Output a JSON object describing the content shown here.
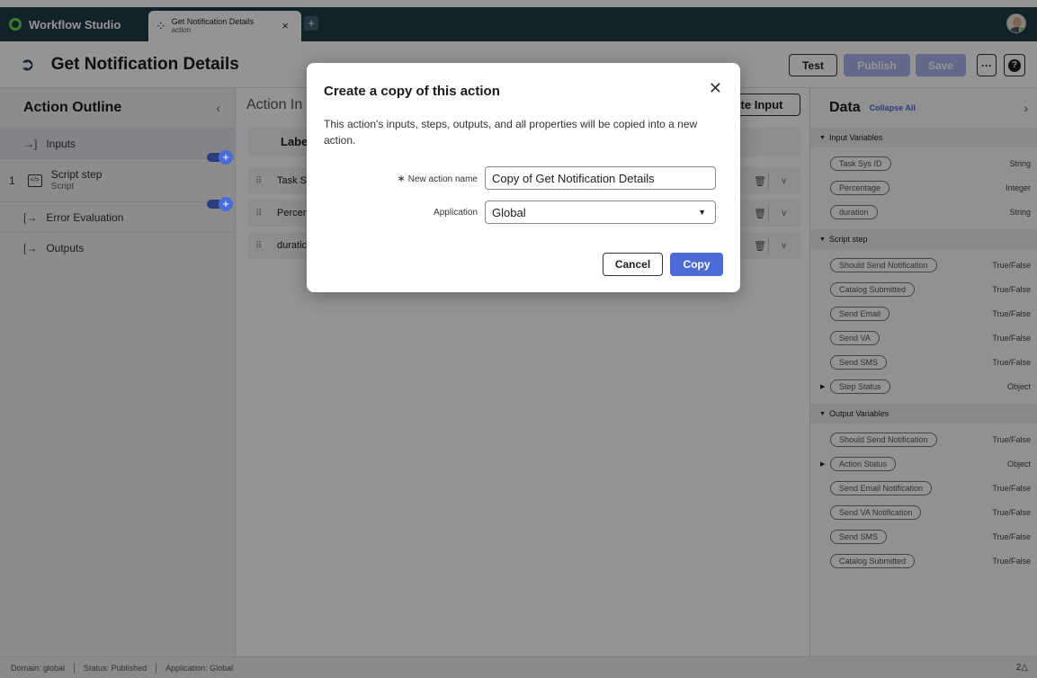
{
  "app": {
    "name": "Workflow Studio"
  },
  "tab": {
    "title": "Get Notification Details",
    "subtitle": "action",
    "close": "×",
    "add": "+"
  },
  "header": {
    "title": "Get Notification Details",
    "buttons": {
      "test": "Test",
      "publish": "Publish",
      "save": "Save",
      "more": "···",
      "help": "?"
    }
  },
  "outline": {
    "title": "Action Outline",
    "collapse": "‹",
    "inputs": "Inputs",
    "step": {
      "number": "1",
      "label": "Script step",
      "sublabel": "Script",
      "icon_text": "</>"
    },
    "error": "Error Evaluation",
    "outputs": "Outputs",
    "plus": "+"
  },
  "middle": {
    "heading": "Action In",
    "create_button": "te Input",
    "table_header": "Labe",
    "rows": [
      {
        "name": "Task Sy"
      },
      {
        "name": "Percen"
      },
      {
        "name": "duratic"
      }
    ]
  },
  "data_panel": {
    "title": "Data",
    "collapse_all": "Collapse All",
    "chevron": "›",
    "sections": [
      {
        "title": "Input Variables",
        "items": [
          {
            "name": "Task Sys ID",
            "type": "String",
            "expandable": false
          },
          {
            "name": "Percentage",
            "type": "Integer",
            "expandable": false
          },
          {
            "name": "duration",
            "type": "String",
            "expandable": false
          }
        ]
      },
      {
        "title": "Script step",
        "items": [
          {
            "name": "Should Send Notification",
            "type": "True/False",
            "expandable": false
          },
          {
            "name": "Catalog Submitted",
            "type": "True/False",
            "expandable": false
          },
          {
            "name": "Send Email",
            "type": "True/False",
            "expandable": false
          },
          {
            "name": "Send VA",
            "type": "True/False",
            "expandable": false
          },
          {
            "name": "Send SMS",
            "type": "True/False",
            "expandable": false
          },
          {
            "name": "Step Status",
            "type": "Object",
            "expandable": true
          }
        ]
      },
      {
        "title": "Output Variables",
        "items": [
          {
            "name": "Should Send Notification",
            "type": "True/False",
            "expandable": false
          },
          {
            "name": "Action Status",
            "type": "Object",
            "expandable": true
          },
          {
            "name": "Send Email Notification",
            "type": "True/False",
            "expandable": false
          },
          {
            "name": "Send VA Notification",
            "type": "True/False",
            "expandable": false
          },
          {
            "name": "Send SMS",
            "type": "True/False",
            "expandable": false
          },
          {
            "name": "Catalog Submitted",
            "type": "True/False",
            "expandable": false
          }
        ]
      }
    ]
  },
  "status_bar": {
    "domain": "Domain: global",
    "status": "Status: Published",
    "application": "Application: Global",
    "alerts": "2△"
  },
  "modal": {
    "title": "Create a copy of this action",
    "close": "✕",
    "description": "This action's inputs, steps, outputs, and all properties will be copied into a new action.",
    "name_label": "New action name",
    "required_mark": "∗",
    "name_value": "Copy of Get Notification Details",
    "app_label": "Application",
    "app_value": "Global",
    "cancel": "Cancel",
    "copy": "Copy"
  },
  "colors": {
    "appbar": "#1f3b4a",
    "accent": "#4b6bd6",
    "brand_green": "#62d84e",
    "disabled_button": "#a9b6ef"
  }
}
